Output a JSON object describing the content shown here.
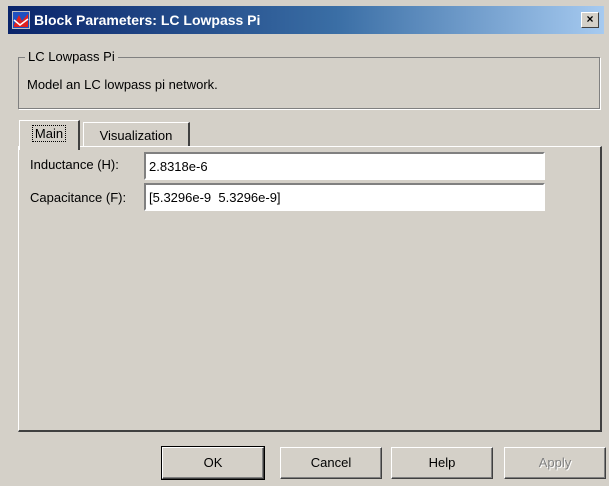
{
  "window": {
    "title": "Block Parameters: LC Lowpass Pi",
    "close_glyph": "×"
  },
  "group": {
    "legend": "LC Lowpass Pi",
    "description": "Model an LC lowpass pi network."
  },
  "tabs": [
    {
      "label": "Main",
      "active": true
    },
    {
      "label": "Visualization",
      "active": false
    }
  ],
  "fields": {
    "inductance": {
      "label": "Inductance (H):",
      "value": "2.8318e-6"
    },
    "capacitance": {
      "label": "Capacitance (F):",
      "value": "[5.3296e-9  5.3296e-9]"
    }
  },
  "buttons": {
    "ok": "OK",
    "cancel": "Cancel",
    "help": "Help",
    "apply": "Apply"
  },
  "colors": {
    "face": "#d4d0c8",
    "title_start": "#0a246a",
    "title_end": "#a6caf0"
  },
  "icons": {
    "title": "simulink-block-icon",
    "close": "close-icon"
  }
}
